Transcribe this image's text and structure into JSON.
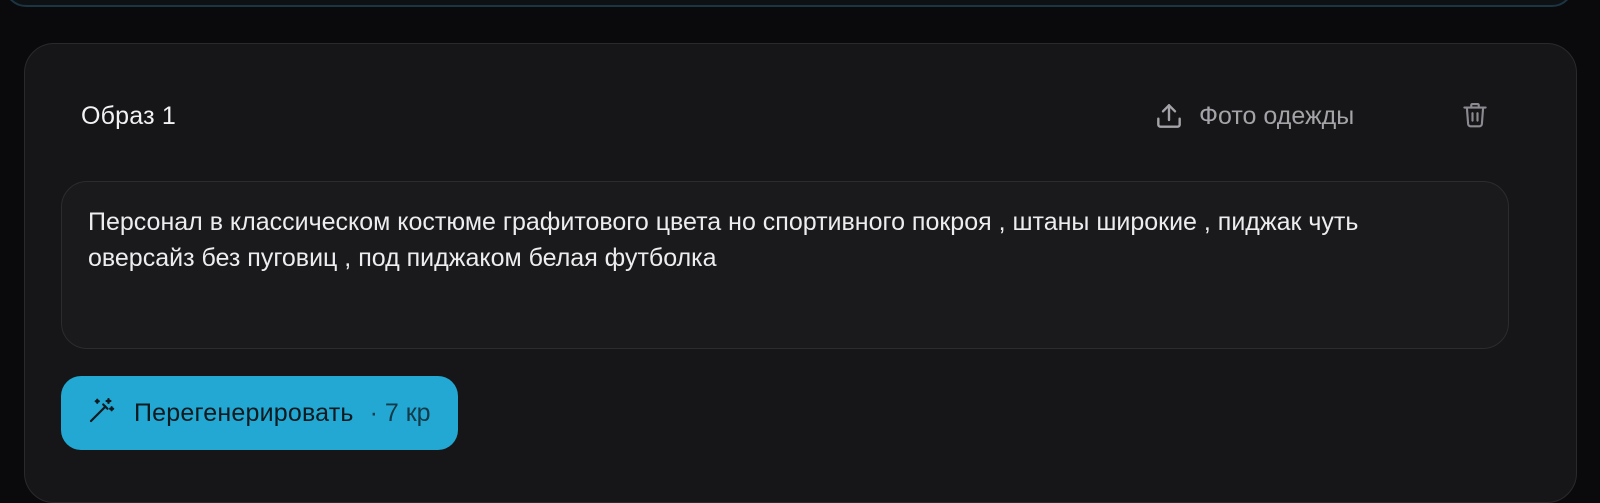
{
  "look": {
    "title": "Образ 1",
    "upload_label": "Фото одежды",
    "prompt_text": "Персонал в классическом костюме графитового цвета но спортивного покроя , штаны широкие , пиджак чуть оверсайз без пуговиц , под пиджаком белая футболка",
    "regenerate_label": "Перегенерировать",
    "regenerate_cost": "· 7 кр",
    "icons": {
      "upload": "upload-icon",
      "delete": "trash-icon",
      "regenerate": "magic-wand-icon"
    }
  },
  "colors": {
    "background": "#0a0a0c",
    "card": "#161618",
    "accent": "#22a8d2",
    "text": "#ededf0",
    "muted": "#a3a3a8"
  }
}
